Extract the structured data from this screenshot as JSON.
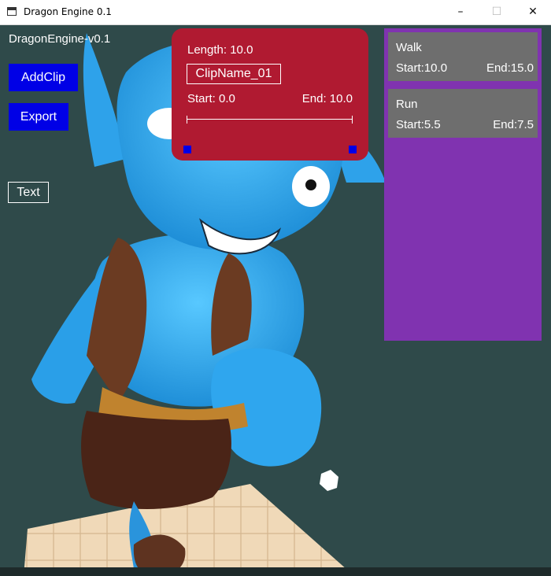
{
  "window": {
    "title": "Dragon Engine 0.1",
    "minimize_glyph": "–",
    "maximize_glyph": "☐",
    "close_glyph": "✕"
  },
  "overlay": {
    "version": "DragonEngine-v0.1",
    "add_clip_label": "AddClip",
    "export_label": "Export",
    "text_label": "Text"
  },
  "clip_editor": {
    "length": "Length: 10.0",
    "clip_name": "ClipName_01",
    "start": "Start: 0.0",
    "end": "End: 10.0"
  },
  "animations": [
    {
      "name": "Walk",
      "start": "Start:10.0",
      "end": "End:15.0"
    },
    {
      "name": "Run",
      "start": "Start:5.5",
      "end": "End:7.5"
    }
  ],
  "colors": {
    "viewport_bg": "#2f4a4a",
    "button_blue": "#0000e6",
    "clip_panel": "#b01a31",
    "anim_panel": "#8033b0",
    "anim_item": "#6e6e6e",
    "character_skin": "#3aaef0"
  }
}
